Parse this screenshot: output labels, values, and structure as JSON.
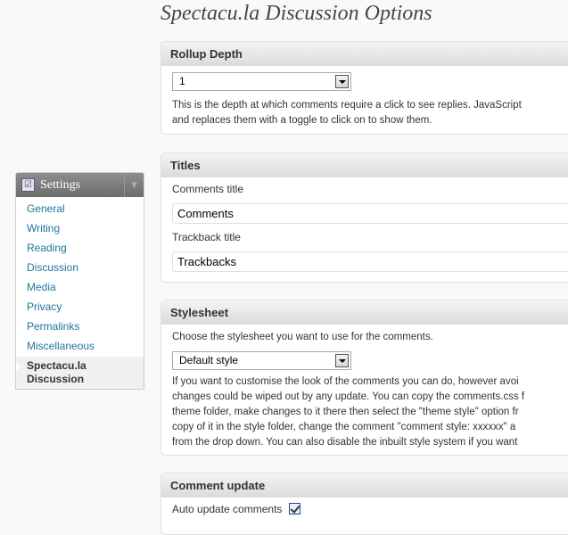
{
  "page_title": "Spectacu.la Discussion Options",
  "menu": {
    "title": "Settings",
    "icon": "settings-icon",
    "items": [
      {
        "label": "General"
      },
      {
        "label": "Writing"
      },
      {
        "label": "Reading"
      },
      {
        "label": "Discussion"
      },
      {
        "label": "Media"
      },
      {
        "label": "Privacy"
      },
      {
        "label": "Permalinks"
      },
      {
        "label": "Miscellaneous"
      }
    ],
    "current_line1": "Spectacu.la",
    "current_line2": "Discussion"
  },
  "rollup": {
    "heading": "Rollup Depth",
    "selected": "1",
    "desc_line1": "This is the depth at which comments require a click to see replies. JavaScript",
    "desc_line2": "and replaces them with a toggle to click on to show them."
  },
  "titles": {
    "heading": "Titles",
    "comments_label": "Comments title",
    "comments_value": "Comments",
    "trackback_label": "Trackback title",
    "trackback_value": "Trackbacks"
  },
  "stylesheet": {
    "heading": "Stylesheet",
    "intro": "Choose the stylesheet you want to use for the comments.",
    "selected": "Default style",
    "desc_lines": [
      "If you want to customise the look of the comments you can do, however avoi",
      "changes could be wiped out by any update. You can copy the comments.css f",
      "theme folder, make changes to it there then select the \"theme style\" option fr",
      "copy of it in the style folder, change the comment \"comment style: xxxxxx\" a",
      "from the drop down. You can also disable the inbuilt style system if you want"
    ]
  },
  "comment_update": {
    "heading": "Comment update",
    "auto_label": "Auto update comments",
    "auto_checked": true
  }
}
